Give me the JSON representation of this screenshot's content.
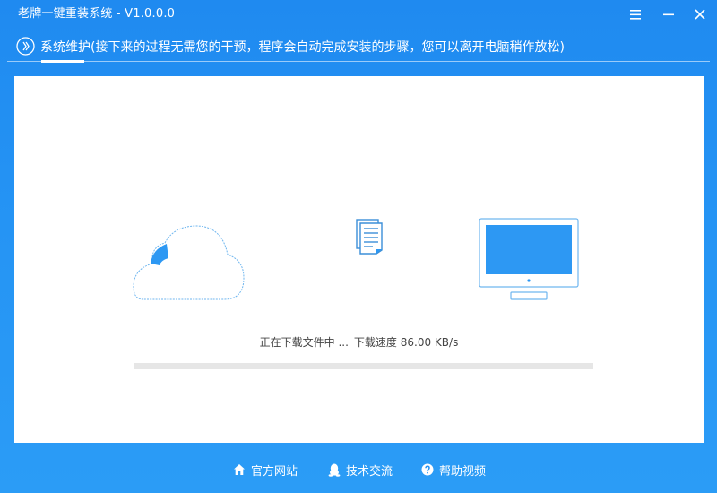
{
  "window": {
    "title": "老牌一键重装系统 - V1.0.0.0"
  },
  "titlebar_buttons": {
    "menu_icon": "menu-icon",
    "minimize_icon": "minimize-icon",
    "close_icon": "close-icon"
  },
  "step": {
    "icon": "chevron-right-circle-icon",
    "text": "系统维护(接下来的过程无需您的干预，程序会自动完成安装的步骤，您可以离开电脑稍作放松)"
  },
  "download": {
    "status_text": "正在下载文件中 ...",
    "speed_label": "下载速度",
    "speed_value": "86.00 KB/s",
    "progress_fraction": 0.0,
    "icons": {
      "source": "cloud-icon",
      "file": "document-icon",
      "target": "monitor-icon"
    }
  },
  "footer": {
    "links": [
      {
        "label": "官方网站",
        "icon": "home-icon"
      },
      {
        "label": "技术交流",
        "icon": "qq-penguin-icon"
      },
      {
        "label": "帮助视频",
        "icon": "help-circle-icon"
      }
    ]
  },
  "colors": {
    "background": "#2594f4",
    "accent": "#2d98f3",
    "panel": "#ffffff",
    "progress_track": "#e6e6e6"
  }
}
